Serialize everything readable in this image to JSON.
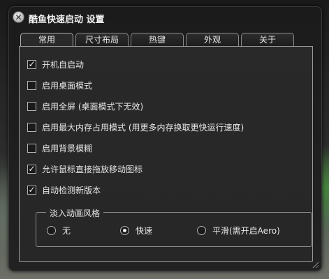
{
  "window": {
    "title": "酷鱼快速启动 设置",
    "close_glyph": "✕"
  },
  "tabs": [
    {
      "label": "常用",
      "active": true
    },
    {
      "label": "尺寸布局",
      "active": false
    },
    {
      "label": "热键",
      "active": false
    },
    {
      "label": "外观",
      "active": false
    },
    {
      "label": "关于",
      "active": false
    }
  ],
  "options": [
    {
      "label": "开机自启动",
      "checked": true
    },
    {
      "label": "启用桌面模式",
      "checked": false
    },
    {
      "label": "启用全屏 (桌面模式下无效)",
      "checked": false
    },
    {
      "label": "启用最大内存占用模式 (用更多内存换取更快运行速度)",
      "checked": false
    },
    {
      "label": "启用背景模糊",
      "checked": false
    },
    {
      "label": "允许鼠标直接拖放移动图标",
      "checked": true
    },
    {
      "label": "自动检测新版本",
      "checked": true
    }
  ],
  "animation_style": {
    "title": "淡入动画风格",
    "options": [
      {
        "label": "无",
        "selected": false
      },
      {
        "label": "快速",
        "selected": true
      },
      {
        "label": "平滑(需开启Aero)",
        "selected": false
      }
    ]
  },
  "check_glyph": "✓"
}
